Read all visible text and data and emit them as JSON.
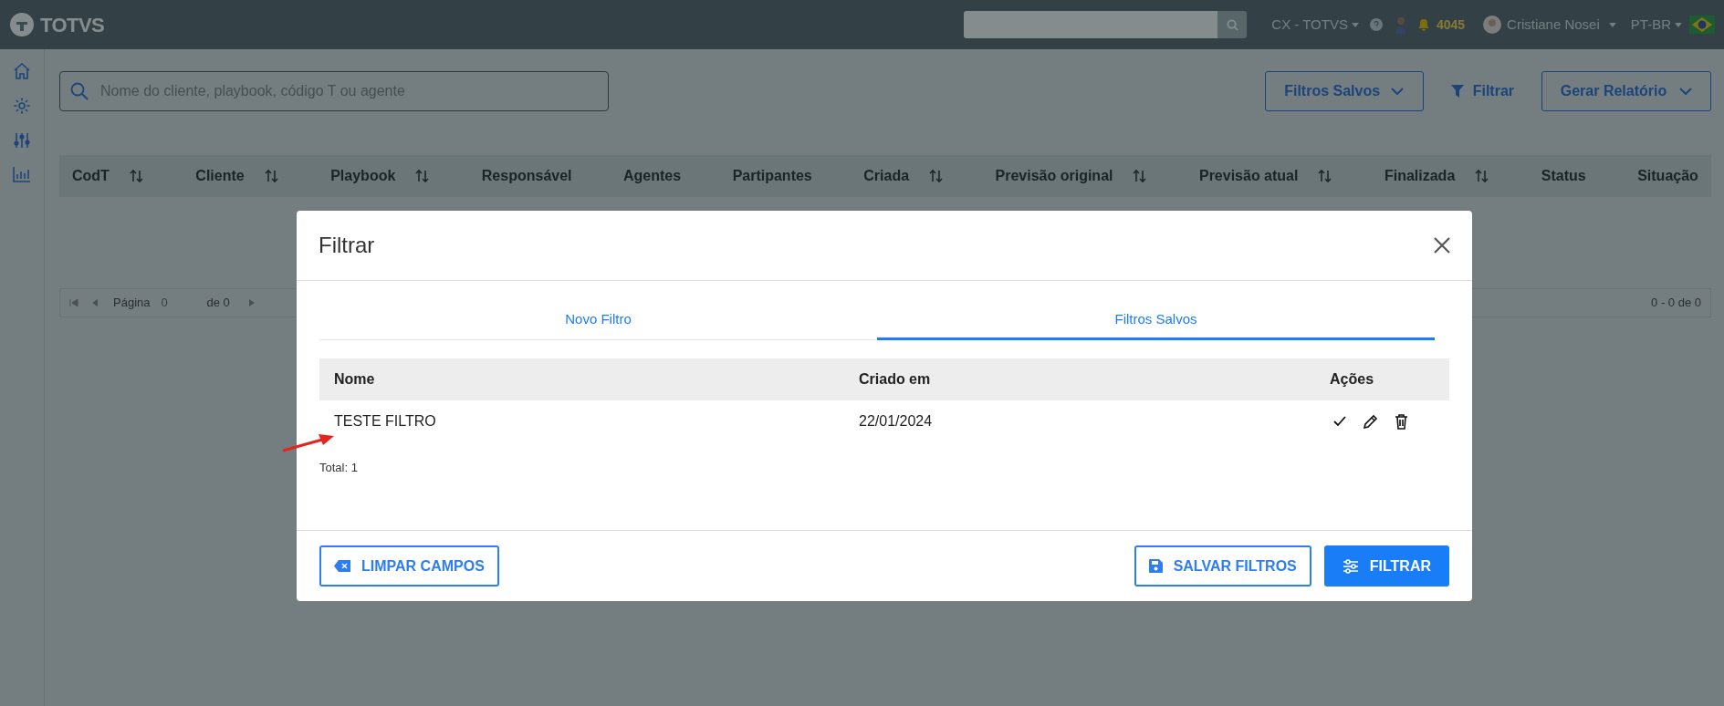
{
  "topbar": {
    "brand": "TOTVS",
    "org": "CX - TOTVS",
    "notifications": "4045",
    "user": "Cristiane Nosei",
    "language": "PT-BR"
  },
  "search": {
    "placeholder": "Nome do cliente, playbook, código T ou agente"
  },
  "actions": {
    "saved_filters": "Filtros Salvos",
    "filter": "Filtrar",
    "report": "Gerar Relatório"
  },
  "table": {
    "columns": [
      {
        "label": "CodT",
        "sortable": true
      },
      {
        "label": "Cliente",
        "sortable": true
      },
      {
        "label": "Playbook",
        "sortable": true
      },
      {
        "label": "Responsável",
        "sortable": false
      },
      {
        "label": "Agentes",
        "sortable": false
      },
      {
        "label": "Partipantes",
        "sortable": false
      },
      {
        "label": "Criada",
        "sortable": true
      },
      {
        "label": "Previsão original",
        "sortable": true
      },
      {
        "label": "Previsão atual",
        "sortable": true
      },
      {
        "label": "Finalizada",
        "sortable": true
      },
      {
        "label": "Status",
        "sortable": false
      },
      {
        "label": "Situação",
        "sortable": false
      }
    ]
  },
  "pagination": {
    "page_label": "Página",
    "page": "0",
    "of": "de 0",
    "range": "0 - 0 de 0"
  },
  "modal": {
    "title": "Filtrar",
    "tabs": [
      {
        "label": "Novo Filtro",
        "selected": false
      },
      {
        "label": "Filtros Salvos",
        "selected": true
      }
    ],
    "saved": {
      "columns": [
        "Nome",
        "Criado em",
        "Ações"
      ],
      "rows": [
        {
          "name": "TESTE FILTRO",
          "created": "22/01/2024"
        }
      ],
      "total": "Total: 1"
    },
    "buttons": {
      "clear": "LIMPAR CAMPOS",
      "save": "SALVAR FILTROS",
      "apply": "FILTRAR"
    }
  }
}
